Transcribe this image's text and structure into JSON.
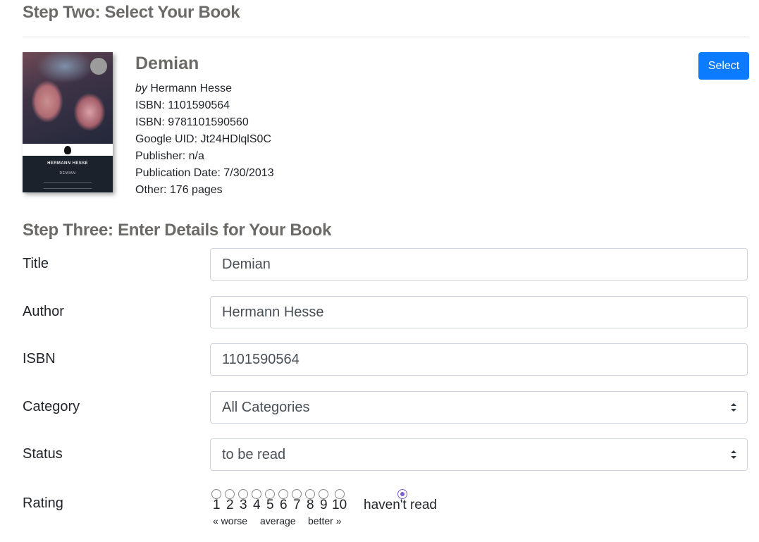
{
  "step_two": {
    "heading": "Step Two: Select Your Book",
    "book": {
      "title": "Demian",
      "by_prefix": "by",
      "author": "Hermann Hesse",
      "isbn10": "ISBN: 1101590564",
      "isbn13": "ISBN: 9781101590560",
      "google_uid": "Google UID: Jt24HDlqlS0C",
      "publisher": "Publisher: n/a",
      "publication_date": "Publication Date: 7/30/2013",
      "other": "Other: 176 pages",
      "cover": {
        "author": "HERMANN HESSE",
        "title": "DEMIAN"
      }
    },
    "select_label": "Select"
  },
  "step_three": {
    "heading": "Step Three: Enter Details for Your Book",
    "fields": {
      "title": {
        "label": "Title",
        "value": "Demian"
      },
      "author": {
        "label": "Author",
        "value": "Hermann Hesse"
      },
      "isbn": {
        "label": "ISBN",
        "value": "1101590564"
      },
      "category": {
        "label": "Category",
        "value": "All Categories"
      },
      "status": {
        "label": "Status",
        "value": "to be read"
      }
    },
    "rating": {
      "label": "Rating",
      "numbers": [
        "1",
        "2",
        "3",
        "4",
        "5",
        "6",
        "7",
        "8",
        "9",
        "10"
      ],
      "no_rating_label": "haven't read",
      "selected": "haven't read",
      "scale_worse": "« worse",
      "scale_average": "average",
      "scale_better": "better »"
    }
  },
  "colors": {
    "primary_button": "#0b7bff",
    "heading": "#6c6a66",
    "radio_checked": "#7b5fc7"
  }
}
